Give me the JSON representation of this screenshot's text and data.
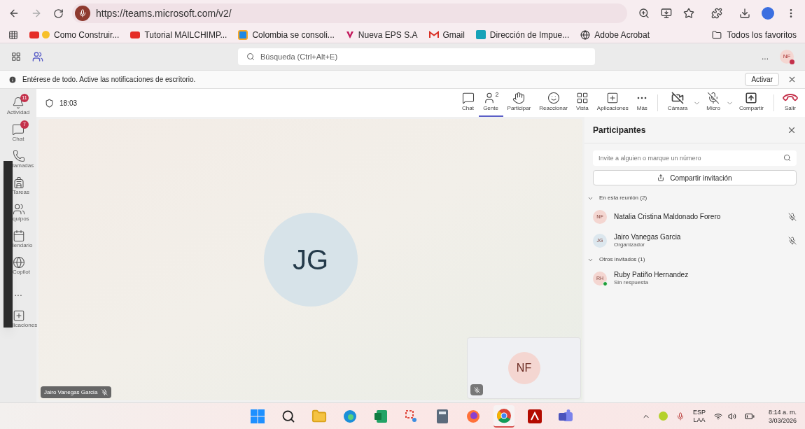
{
  "browser": {
    "url": "https://teams.microsoft.com/v2/",
    "bookmarks": [
      {
        "label": "Como Construir...",
        "kind": "youtube-emoji"
      },
      {
        "label": "Tutorial MAILCHIMP...",
        "kind": "youtube"
      },
      {
        "label": "Colombia se consoli...",
        "kind": "tile"
      },
      {
        "label": "Nueva EPS S.A",
        "kind": "v"
      },
      {
        "label": "Gmail",
        "kind": "gmail"
      },
      {
        "label": "Dirección de Impue...",
        "kind": "dian"
      },
      {
        "label": "Adobe Acrobat",
        "kind": "acrobat"
      }
    ],
    "all_bookmarks": "Todos los favoritos"
  },
  "teams": {
    "search_placeholder": "Búsqueda (Ctrl+Alt+E)",
    "more": "...",
    "avatar": "NF"
  },
  "notification": {
    "text": "Entérese de todo. Active las notificaciones de escritorio.",
    "button": "Activar"
  },
  "sidebar": [
    {
      "label": "Actividad",
      "kind": "bell",
      "badge": "11"
    },
    {
      "label": "Chat",
      "kind": "chat",
      "badge": "7"
    },
    {
      "label": "lamadas",
      "kind": "phone"
    },
    {
      "label": "Tareas",
      "kind": "bag"
    },
    {
      "label": "quipos",
      "kind": "teams"
    },
    {
      "label": "lendario",
      "kind": "calendar"
    },
    {
      "label": "Copilot",
      "kind": "copilot"
    },
    {
      "label": "...",
      "kind": "more"
    },
    {
      "label": "licaciones",
      "kind": "apps"
    }
  ],
  "meeting": {
    "timer": "18:03",
    "toolbar": [
      {
        "label": "Chat",
        "kind": "chat",
        "selected": false
      },
      {
        "label": "Gente",
        "kind": "people",
        "selected": true,
        "badge": "2"
      },
      {
        "label": "Participar",
        "kind": "hand",
        "selected": false
      },
      {
        "label": "Reaccionar",
        "kind": "smile",
        "selected": false
      },
      {
        "label": "Vista",
        "kind": "grid",
        "selected": false
      },
      {
        "label": "Aplicaciones",
        "kind": "apps",
        "selected": false
      },
      {
        "label": "Más",
        "kind": "more",
        "selected": false
      },
      {
        "label": "Cámara",
        "kind": "camera",
        "selected": false,
        "on": false
      },
      {
        "label": "Micro",
        "kind": "mic",
        "selected": false,
        "on": false
      },
      {
        "label": "Compartir",
        "kind": "share",
        "selected": false
      },
      {
        "label": "Salir",
        "kind": "leave",
        "selected": false
      }
    ]
  },
  "stage": {
    "main_initials": "JG",
    "main_name": "Jairo Vanegas Garcia",
    "self_initials": "NF"
  },
  "panel": {
    "title": "Participantes",
    "invite_placeholder": "Invite a alguien o marque un número",
    "share_button": "Compartir invitación",
    "groups": [
      {
        "label": "En esta reunión (2)",
        "expanded": true,
        "people": [
          {
            "initials": "NF",
            "name": "Natalia Cristina Maldonado Forero",
            "color": "#f4d6d1",
            "muted": true
          },
          {
            "initials": "JG",
            "name": "Jairo Vanegas Garcia",
            "subtitle": "Organizador",
            "color": "#dce7ee",
            "muted": true
          }
        ]
      },
      {
        "label": "Otros invitados (1)",
        "expanded": true,
        "people": [
          {
            "initials": "RH",
            "name": "Ruby Patiño Hernandez",
            "subtitle": "Sin respuesta",
            "color": "#f4d6d1",
            "status": {
              "color": "#1e9e3a"
            }
          }
        ]
      }
    ]
  },
  "taskbar": {
    "icons": [
      {
        "kind": "start",
        "active": false
      },
      {
        "kind": "search",
        "active": false
      },
      {
        "kind": "explorer",
        "active": false
      },
      {
        "kind": "edge",
        "active": false
      },
      {
        "kind": "excel",
        "active": false
      },
      {
        "kind": "snip",
        "active": false
      },
      {
        "kind": "calculator",
        "active": false
      },
      {
        "kind": "firefox",
        "active": false
      },
      {
        "kind": "chrome",
        "active": true
      },
      {
        "kind": "acrobat",
        "active": false
      },
      {
        "kind": "teams",
        "active": false
      }
    ],
    "language": "ESP",
    "layout": "LAA",
    "time": "8:14 a. m.",
    "date": "3/03/2026"
  }
}
